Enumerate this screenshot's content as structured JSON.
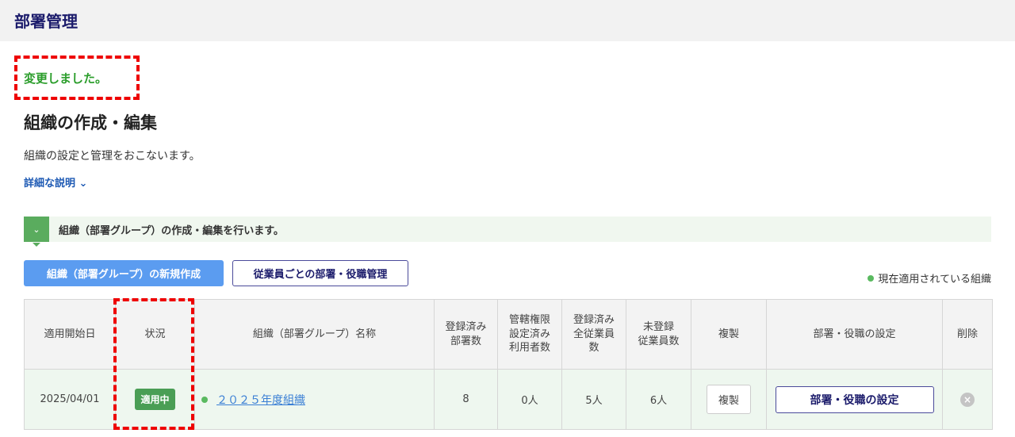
{
  "header": {
    "title": "部署管理"
  },
  "flash": "変更しました。",
  "page": {
    "title": "組織の作成・編集",
    "description": "組織の設定と管理をおこないます。",
    "details_link": "詳細な説明"
  },
  "info": "組織（部署グループ）の作成・編集を行います。",
  "buttons": {
    "create": "組織（部署グループ）の新規作成",
    "manage": "従業員ごとの部署・役職管理"
  },
  "legend": "現在適用されている組織",
  "table": {
    "headers": [
      "適用開始日",
      "状況",
      "組織（部署グループ）名称",
      "登録済み部署数",
      "管轄権限設定済み利用者数",
      "登録済み全従業員数",
      "未登録従業員数",
      "複製",
      "部署・役職の設定",
      "削除"
    ],
    "header_lines": [
      [
        "適用開始日"
      ],
      [
        "状況"
      ],
      [
        "組織（部署グループ）名称"
      ],
      [
        "登録済み",
        "部署数"
      ],
      [
        "管轄権限",
        "設定済み",
        "利用者数"
      ],
      [
        "登録済み",
        "全従業員",
        "数"
      ],
      [
        "未登録",
        "従業員数"
      ],
      [
        "複製"
      ],
      [
        "部署・役職の設定"
      ],
      [
        "削除"
      ]
    ],
    "rows": [
      {
        "start_date": "2025/04/01",
        "status": "適用中",
        "name": "２０２５年度組織",
        "departments": "8",
        "managers": "0人",
        "employees": "5人",
        "unregistered": "6人",
        "copy": "複製",
        "settings": "部署・役職の設定",
        "delete": "×"
      }
    ]
  }
}
